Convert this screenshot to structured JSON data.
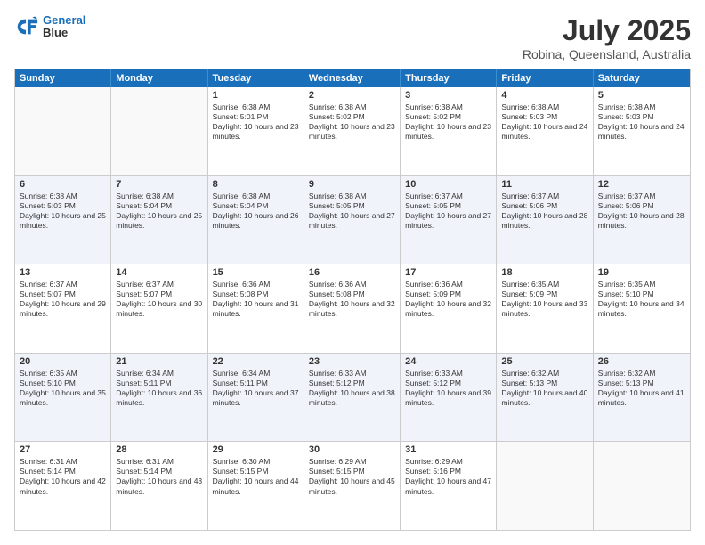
{
  "header": {
    "logo_line1": "General",
    "logo_line2": "Blue",
    "month_year": "July 2025",
    "location": "Robina, Queensland, Australia"
  },
  "days_of_week": [
    "Sunday",
    "Monday",
    "Tuesday",
    "Wednesday",
    "Thursday",
    "Friday",
    "Saturday"
  ],
  "rows": [
    {
      "alt": false,
      "cells": [
        {
          "day": "",
          "text": ""
        },
        {
          "day": "",
          "text": ""
        },
        {
          "day": "1",
          "text": "Sunrise: 6:38 AM\nSunset: 5:01 PM\nDaylight: 10 hours and 23 minutes."
        },
        {
          "day": "2",
          "text": "Sunrise: 6:38 AM\nSunset: 5:02 PM\nDaylight: 10 hours and 23 minutes."
        },
        {
          "day": "3",
          "text": "Sunrise: 6:38 AM\nSunset: 5:02 PM\nDaylight: 10 hours and 23 minutes."
        },
        {
          "day": "4",
          "text": "Sunrise: 6:38 AM\nSunset: 5:03 PM\nDaylight: 10 hours and 24 minutes."
        },
        {
          "day": "5",
          "text": "Sunrise: 6:38 AM\nSunset: 5:03 PM\nDaylight: 10 hours and 24 minutes."
        }
      ]
    },
    {
      "alt": true,
      "cells": [
        {
          "day": "6",
          "text": "Sunrise: 6:38 AM\nSunset: 5:03 PM\nDaylight: 10 hours and 25 minutes."
        },
        {
          "day": "7",
          "text": "Sunrise: 6:38 AM\nSunset: 5:04 PM\nDaylight: 10 hours and 25 minutes."
        },
        {
          "day": "8",
          "text": "Sunrise: 6:38 AM\nSunset: 5:04 PM\nDaylight: 10 hours and 26 minutes."
        },
        {
          "day": "9",
          "text": "Sunrise: 6:38 AM\nSunset: 5:05 PM\nDaylight: 10 hours and 27 minutes."
        },
        {
          "day": "10",
          "text": "Sunrise: 6:37 AM\nSunset: 5:05 PM\nDaylight: 10 hours and 27 minutes."
        },
        {
          "day": "11",
          "text": "Sunrise: 6:37 AM\nSunset: 5:06 PM\nDaylight: 10 hours and 28 minutes."
        },
        {
          "day": "12",
          "text": "Sunrise: 6:37 AM\nSunset: 5:06 PM\nDaylight: 10 hours and 28 minutes."
        }
      ]
    },
    {
      "alt": false,
      "cells": [
        {
          "day": "13",
          "text": "Sunrise: 6:37 AM\nSunset: 5:07 PM\nDaylight: 10 hours and 29 minutes."
        },
        {
          "day": "14",
          "text": "Sunrise: 6:37 AM\nSunset: 5:07 PM\nDaylight: 10 hours and 30 minutes."
        },
        {
          "day": "15",
          "text": "Sunrise: 6:36 AM\nSunset: 5:08 PM\nDaylight: 10 hours and 31 minutes."
        },
        {
          "day": "16",
          "text": "Sunrise: 6:36 AM\nSunset: 5:08 PM\nDaylight: 10 hours and 32 minutes."
        },
        {
          "day": "17",
          "text": "Sunrise: 6:36 AM\nSunset: 5:09 PM\nDaylight: 10 hours and 32 minutes."
        },
        {
          "day": "18",
          "text": "Sunrise: 6:35 AM\nSunset: 5:09 PM\nDaylight: 10 hours and 33 minutes."
        },
        {
          "day": "19",
          "text": "Sunrise: 6:35 AM\nSunset: 5:10 PM\nDaylight: 10 hours and 34 minutes."
        }
      ]
    },
    {
      "alt": true,
      "cells": [
        {
          "day": "20",
          "text": "Sunrise: 6:35 AM\nSunset: 5:10 PM\nDaylight: 10 hours and 35 minutes."
        },
        {
          "day": "21",
          "text": "Sunrise: 6:34 AM\nSunset: 5:11 PM\nDaylight: 10 hours and 36 minutes."
        },
        {
          "day": "22",
          "text": "Sunrise: 6:34 AM\nSunset: 5:11 PM\nDaylight: 10 hours and 37 minutes."
        },
        {
          "day": "23",
          "text": "Sunrise: 6:33 AM\nSunset: 5:12 PM\nDaylight: 10 hours and 38 minutes."
        },
        {
          "day": "24",
          "text": "Sunrise: 6:33 AM\nSunset: 5:12 PM\nDaylight: 10 hours and 39 minutes."
        },
        {
          "day": "25",
          "text": "Sunrise: 6:32 AM\nSunset: 5:13 PM\nDaylight: 10 hours and 40 minutes."
        },
        {
          "day": "26",
          "text": "Sunrise: 6:32 AM\nSunset: 5:13 PM\nDaylight: 10 hours and 41 minutes."
        }
      ]
    },
    {
      "alt": false,
      "cells": [
        {
          "day": "27",
          "text": "Sunrise: 6:31 AM\nSunset: 5:14 PM\nDaylight: 10 hours and 42 minutes."
        },
        {
          "day": "28",
          "text": "Sunrise: 6:31 AM\nSunset: 5:14 PM\nDaylight: 10 hours and 43 minutes."
        },
        {
          "day": "29",
          "text": "Sunrise: 6:30 AM\nSunset: 5:15 PM\nDaylight: 10 hours and 44 minutes."
        },
        {
          "day": "30",
          "text": "Sunrise: 6:29 AM\nSunset: 5:15 PM\nDaylight: 10 hours and 45 minutes."
        },
        {
          "day": "31",
          "text": "Sunrise: 6:29 AM\nSunset: 5:16 PM\nDaylight: 10 hours and 47 minutes."
        },
        {
          "day": "",
          "text": ""
        },
        {
          "day": "",
          "text": ""
        }
      ]
    }
  ]
}
